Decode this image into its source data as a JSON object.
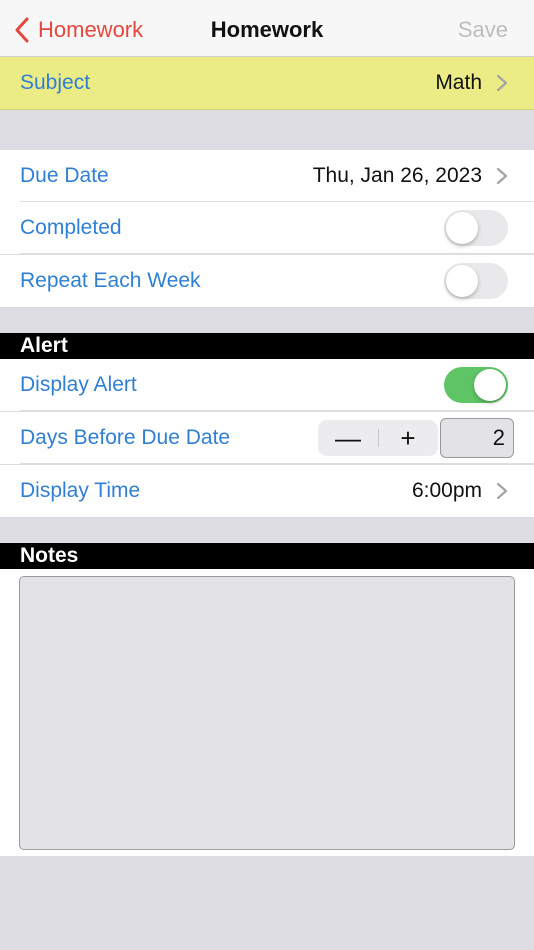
{
  "nav": {
    "back_label": "Homework",
    "title": "Homework",
    "save_label": "Save"
  },
  "subject": {
    "label": "Subject",
    "value": "Math"
  },
  "details": {
    "due_date": {
      "label": "Due Date",
      "value": "Thu, Jan 26, 2023"
    },
    "completed": {
      "label": "Completed",
      "on": false
    },
    "repeat": {
      "label": "Repeat Each Week",
      "on": false
    }
  },
  "alert": {
    "header": "Alert",
    "display_alert": {
      "label": "Display Alert",
      "on": true
    },
    "days_before": {
      "label": "Days Before Due Date",
      "minus": "—",
      "plus": "+",
      "value": "2"
    },
    "display_time": {
      "label": "Display Time",
      "value": "6:00pm"
    }
  },
  "notes": {
    "header": "Notes",
    "value": ""
  },
  "colors": {
    "accent_red": "#e5473d",
    "label_blue": "#2f7fd4",
    "subject_highlight": "#ecec86",
    "toggle_on": "#5fc466"
  }
}
